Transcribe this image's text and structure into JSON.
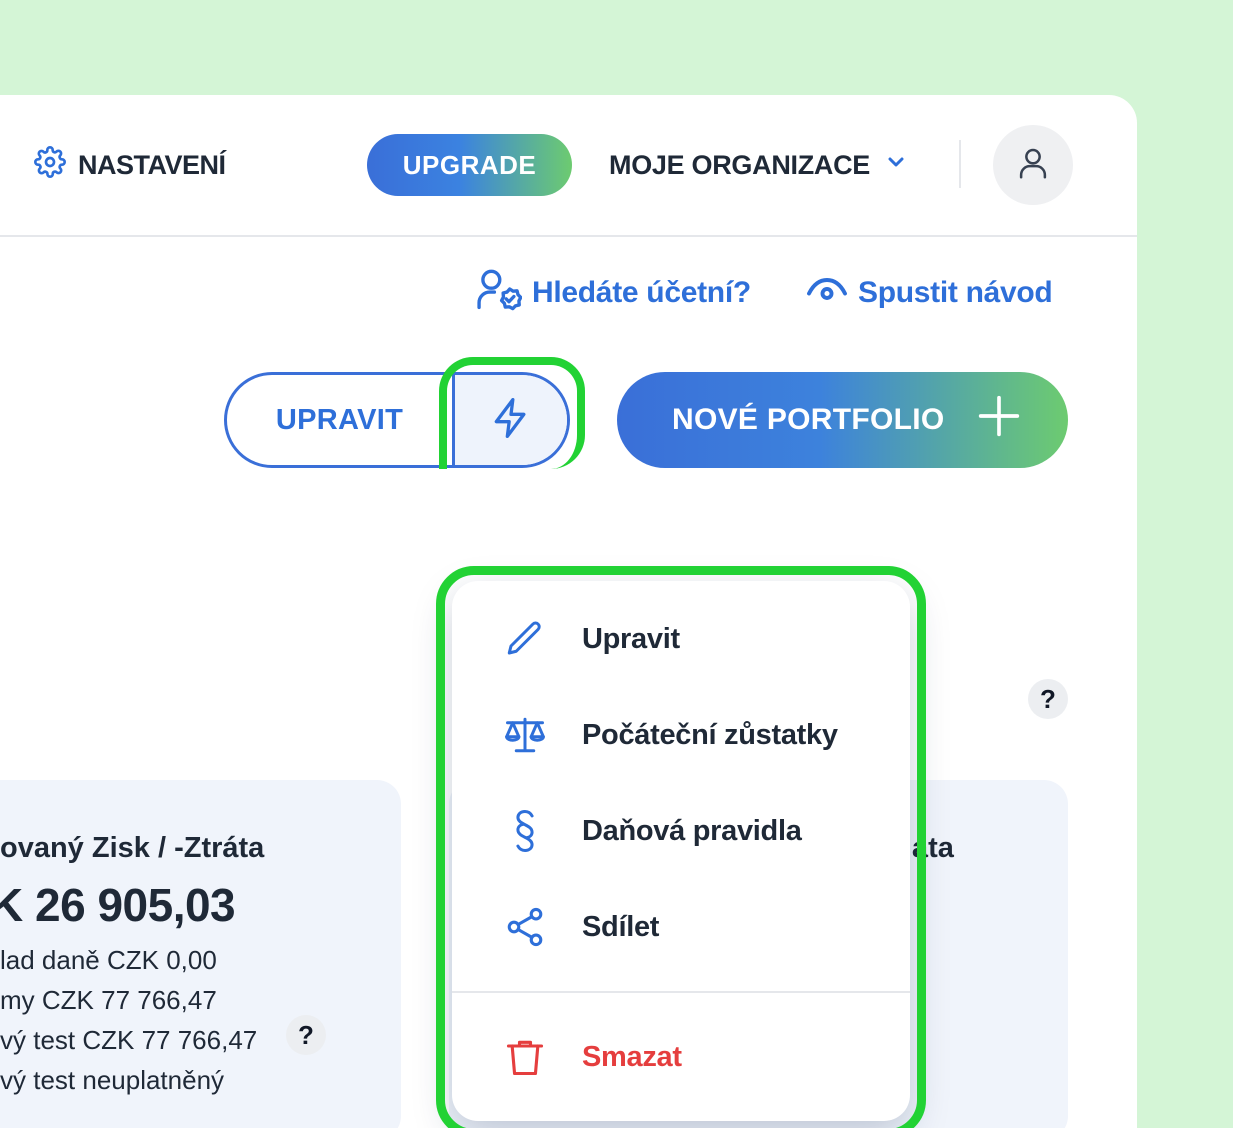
{
  "header": {
    "settings_label": "NASTAVENÍ",
    "upgrade_label": "UPGRADE",
    "organization_label": "MOJE ORGANIZACE"
  },
  "links": {
    "find_accountant": "Hledáte účetní?",
    "start_tutorial": "Spustit návod"
  },
  "actions": {
    "edit_label": "UPRAVIT",
    "new_portfolio_label": "NOVÉ PORTFOLIO"
  },
  "dropdown": {
    "items": [
      {
        "label": "Upravit",
        "icon": "pencil-icon"
      },
      {
        "label": "Počáteční zůstatky",
        "icon": "scales-icon"
      },
      {
        "label": "Daňová pravidla",
        "icon": "section-icon"
      },
      {
        "label": "Sdílet",
        "icon": "share-icon"
      }
    ],
    "delete_label": "Smazat"
  },
  "card_left": {
    "title": "ovaný Zisk / -Ztráta",
    "amount": "K 26 905,03",
    "lines": [
      "lad daně CZK 0,00",
      "my CZK 77 766,47",
      "vý test CZK 77 766,47",
      "vý test neuplatněný"
    ]
  },
  "card_right": {
    "title_fragment": "áta"
  },
  "help_badge": "?",
  "colors": {
    "accent_blue": "#2e6fd9",
    "accent_green": "#6dcb70",
    "highlight": "#22d234",
    "danger": "#e53e3e"
  }
}
